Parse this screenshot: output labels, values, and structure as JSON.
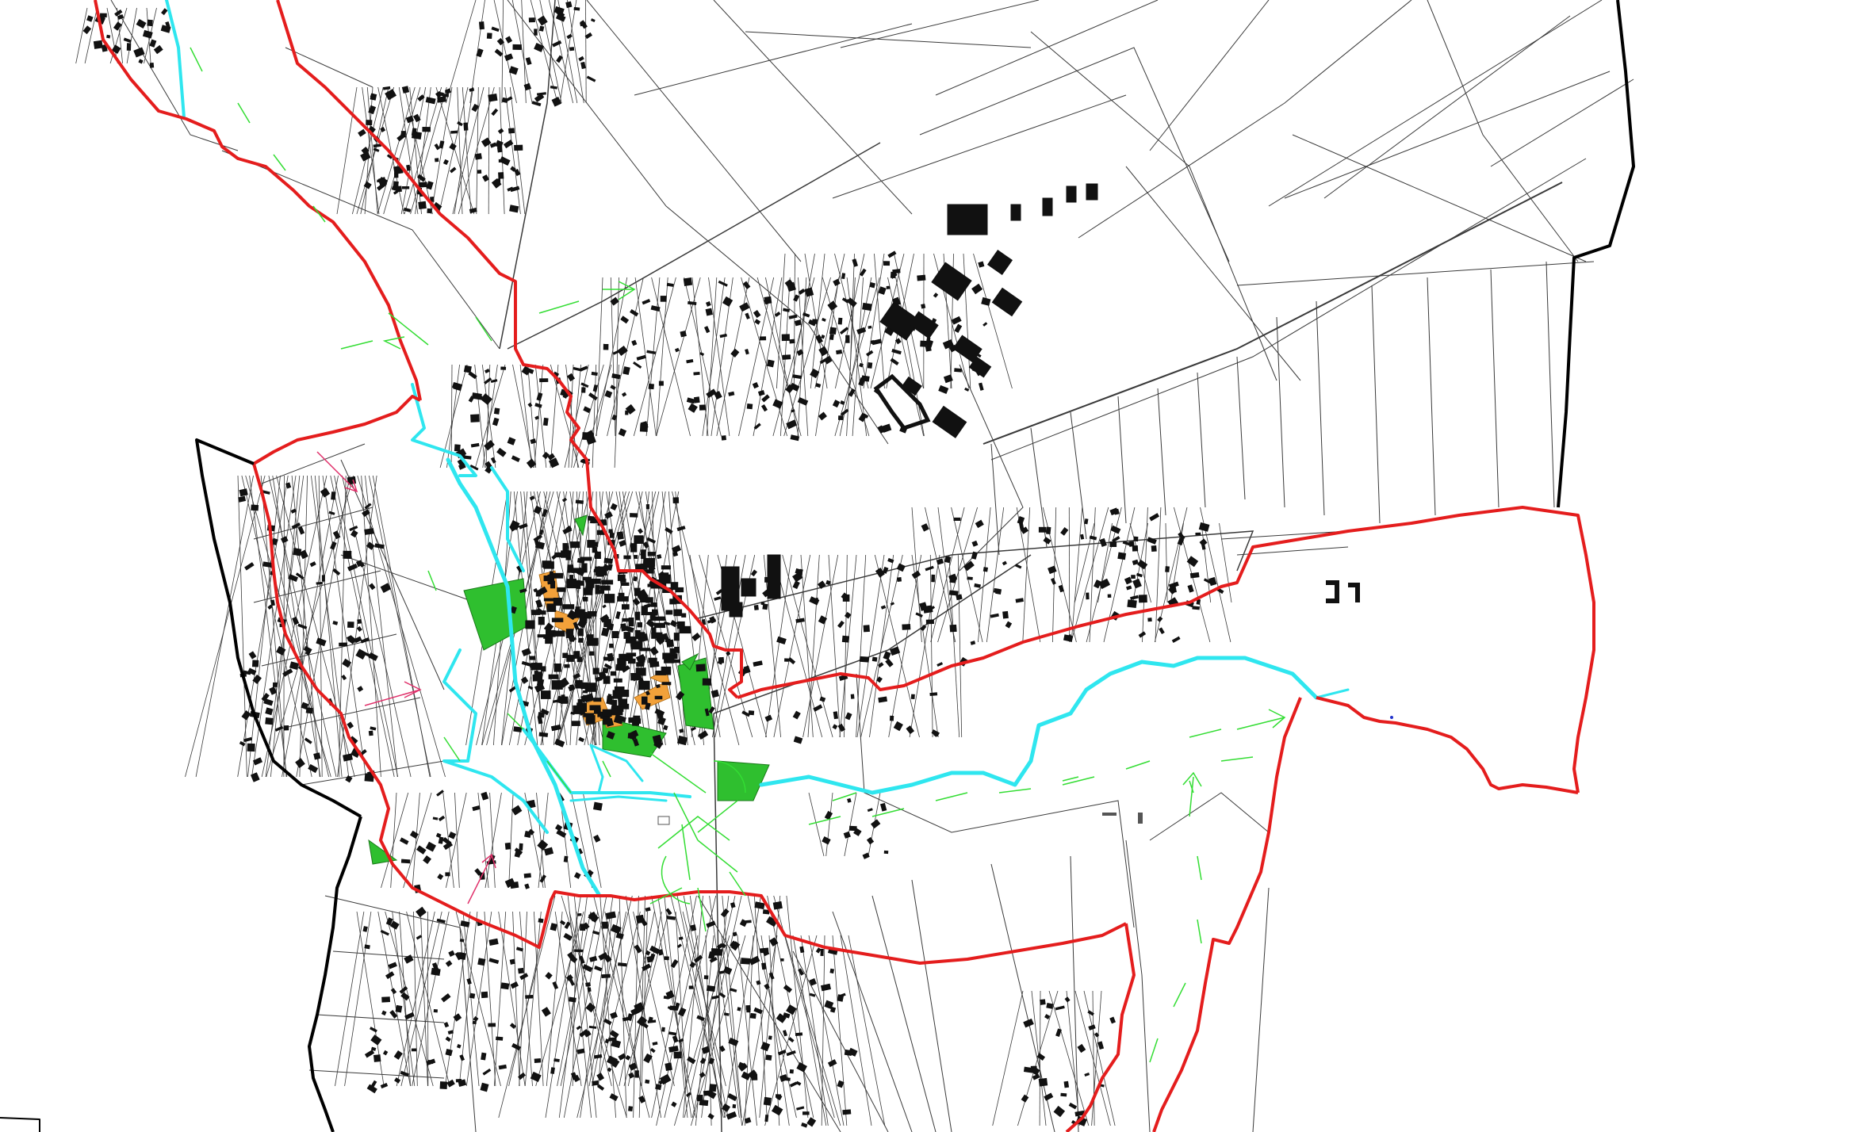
{
  "map": {
    "colors": {
      "background": "#ffffff",
      "parcel_line": "#3a3a3a",
      "building": "#111111",
      "boundary_red": "#e41d1d",
      "boundary_black": "#000000",
      "stream_cyan": "#2fe6ef",
      "green_area": "#2fbf2f",
      "orange_area": "#f2a13a",
      "green_arrow": "#33dd33",
      "pink_arrow": "#e0306a"
    },
    "layers": [
      {
        "id": "cadastral-parcels",
        "type": "line-network"
      },
      {
        "id": "buildings",
        "type": "filled-polygons"
      },
      {
        "id": "municipal-boundary",
        "type": "red-polyline"
      },
      {
        "id": "outer-boundary",
        "type": "black-polyline"
      },
      {
        "id": "watercourse",
        "type": "cyan-polyline"
      },
      {
        "id": "green-spaces",
        "type": "green-fill"
      },
      {
        "id": "historic-core",
        "type": "orange-fill"
      },
      {
        "id": "view-arrows",
        "type": "symbols"
      }
    ],
    "labels": []
  }
}
